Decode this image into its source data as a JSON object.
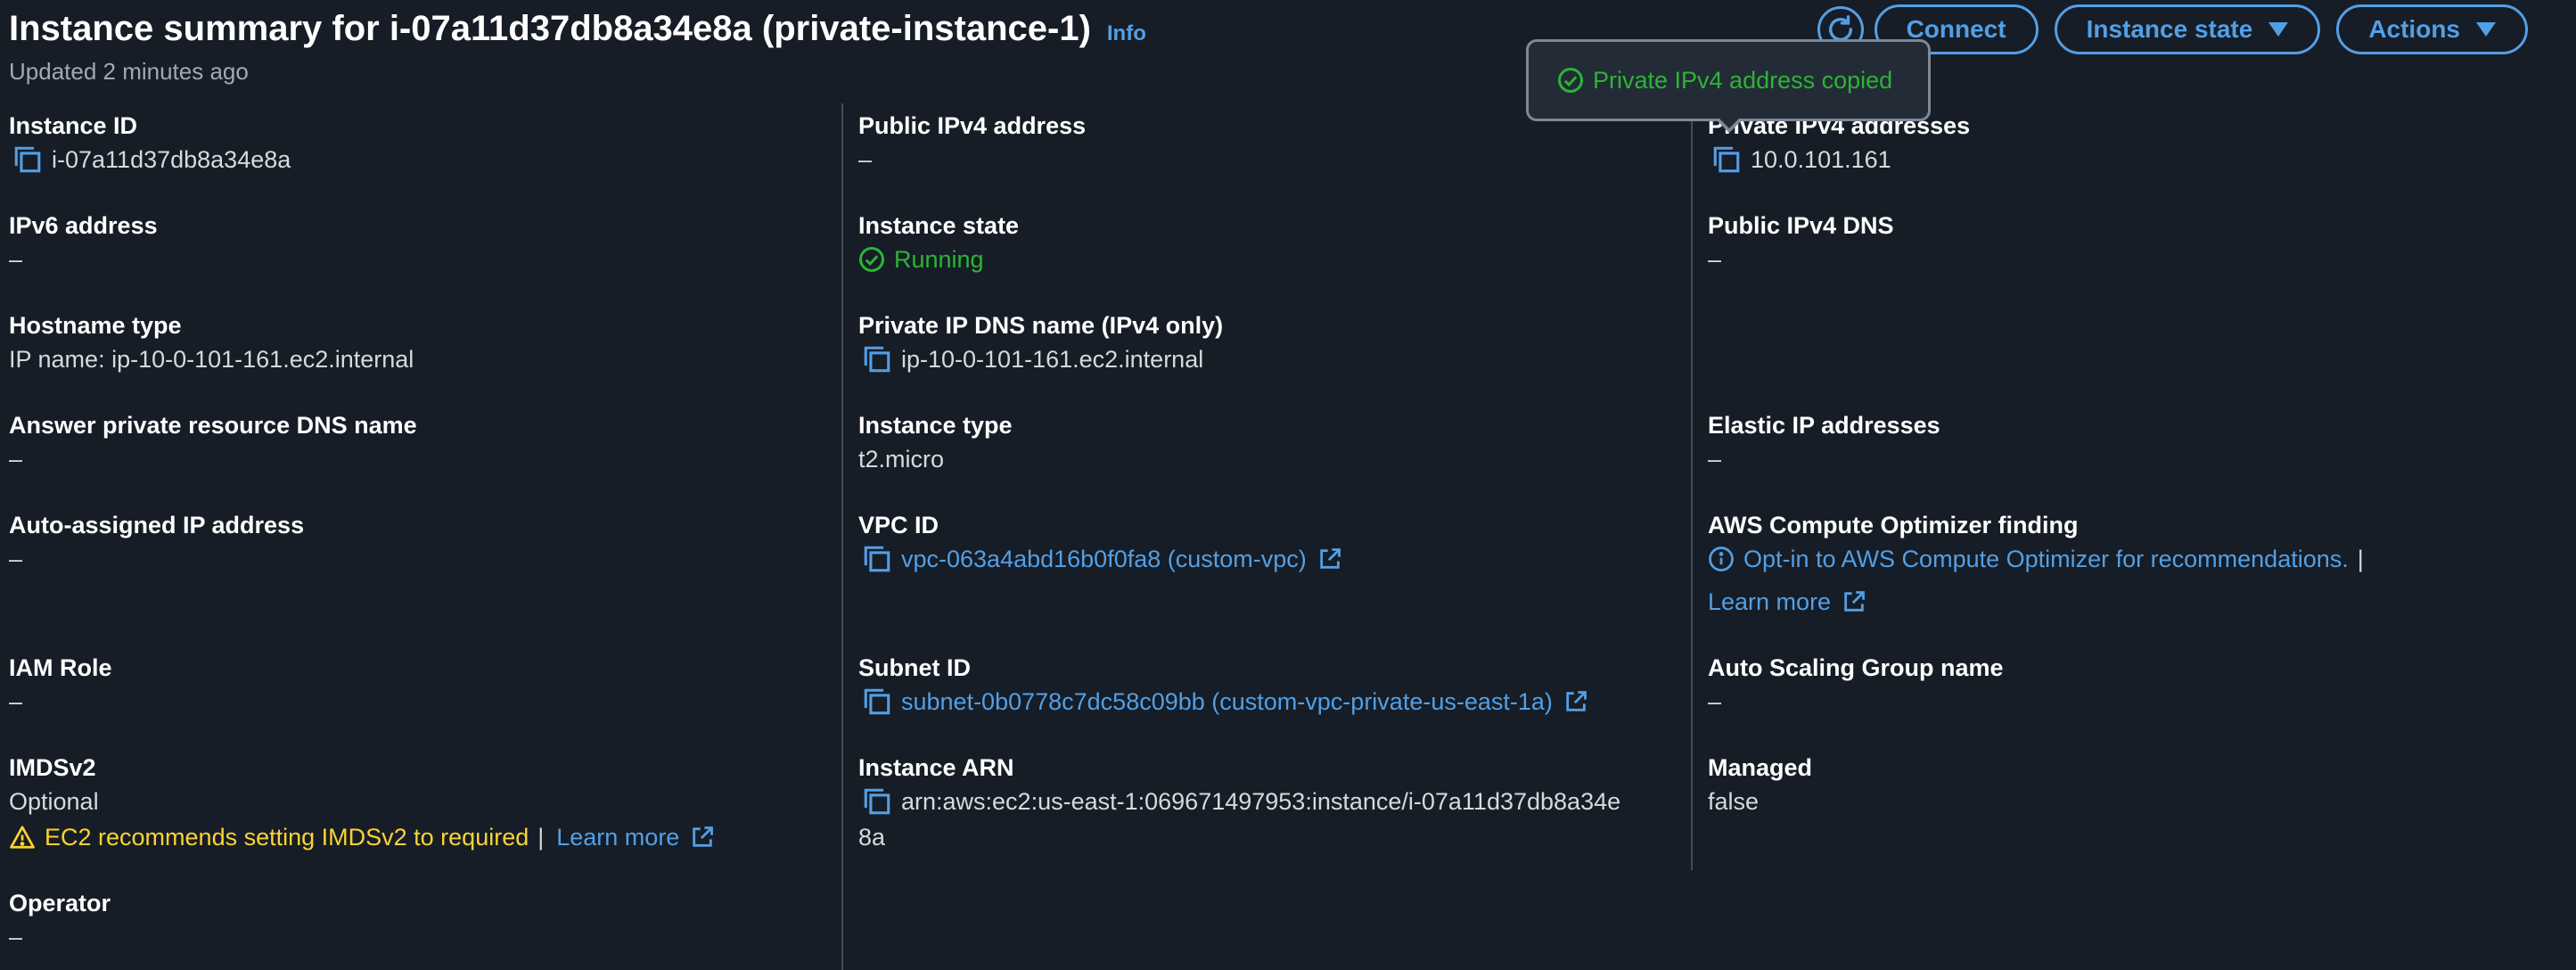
{
  "header": {
    "title": "Instance summary for i-07a11d37db8a34e8a (private-instance-1)",
    "info": "Info",
    "updated": "Updated 2 minutes ago"
  },
  "actions": {
    "connect": "Connect",
    "instance_state": "Instance state",
    "actions": "Actions"
  },
  "toast": {
    "message": "Private IPv4 address copied"
  },
  "col1": {
    "instance_id_label": "Instance ID",
    "instance_id": "i-07a11d37db8a34e8a",
    "ipv6_label": "IPv6 address",
    "ipv6": "–",
    "hostname_type_label": "Hostname type",
    "hostname_type": "IP name: ip-10-0-101-161.ec2.internal",
    "answer_dns_label": "Answer private resource DNS name",
    "answer_dns": "–",
    "auto_ip_label": "Auto-assigned IP address",
    "auto_ip": "–",
    "iam_role_label": "IAM Role",
    "iam_role": "–",
    "imdsv2_label": "IMDSv2",
    "imdsv2": "Optional",
    "imdsv2_warning": "EC2 recommends setting IMDSv2 to required",
    "imdsv2_separator": "|",
    "imdsv2_learn_more": "Learn more",
    "operator_label": "Operator",
    "operator": "–"
  },
  "col2": {
    "public_ipv4_label": "Public IPv4 address",
    "public_ipv4": "–",
    "instance_state_label": "Instance state",
    "instance_state": "Running",
    "private_dns_label": "Private IP DNS name (IPv4 only)",
    "private_dns": "ip-10-0-101-161.ec2.internal",
    "instance_type_label": "Instance type",
    "instance_type": "t2.micro",
    "vpc_id_label": "VPC ID",
    "vpc_id": "vpc-063a4abd16b0f0fa8 (custom-vpc)",
    "subnet_id_label": "Subnet ID",
    "subnet_id": "subnet-0b0778c7dc58c09bb (custom-vpc-private-us-east-1a)",
    "arn_label": "Instance ARN",
    "arn_line1": "arn:aws:ec2:us-east-1:069671497953:instance/i-07a11d37db8a34e",
    "arn_line2": "8a"
  },
  "col3": {
    "private_ipv4_label": "Private IPv4 addresses",
    "private_ipv4": "10.0.101.161",
    "public_dns_label": "Public IPv4 DNS",
    "public_dns": "–",
    "elastic_ip_label": "Elastic IP addresses",
    "elastic_ip": "–",
    "optimizer_label": "AWS Compute Optimizer finding",
    "optimizer_link": "Opt-in to AWS Compute Optimizer for recommendations.",
    "optimizer_separator": "|",
    "optimizer_learn_more": "Learn more",
    "asg_label": "Auto Scaling Group name",
    "asg": "–",
    "managed_label": "Managed",
    "managed": "false"
  },
  "colors": {
    "background": "#161d26",
    "link": "#539fe5",
    "success": "#2bb534",
    "warning": "#fbd332",
    "divider": "#414d5c"
  }
}
